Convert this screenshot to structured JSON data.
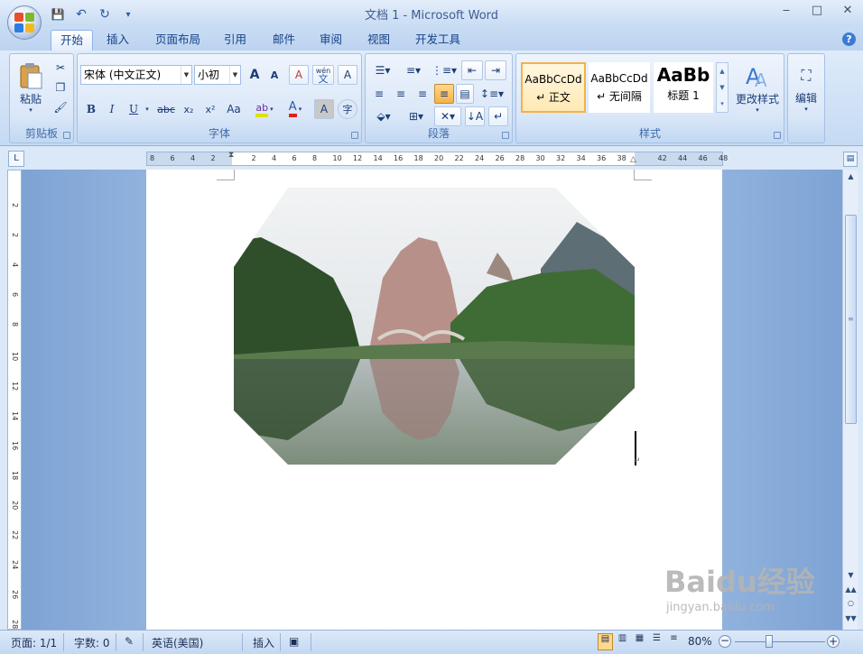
{
  "window": {
    "title": "文档 1 - Microsoft Word",
    "controls": {
      "minimize": "‒",
      "maximize": "□",
      "close": "✕"
    }
  },
  "quick_access": {
    "save": "💾",
    "undo": "↶",
    "redo": "↻",
    "customize": "▾"
  },
  "tabs": [
    {
      "label": "开始",
      "active": true
    },
    {
      "label": "插入"
    },
    {
      "label": "页面布局"
    },
    {
      "label": "引用"
    },
    {
      "label": "邮件"
    },
    {
      "label": "审阅"
    },
    {
      "label": "视图"
    },
    {
      "label": "开发工具"
    }
  ],
  "help": "?",
  "ribbon": {
    "clipboard": {
      "label": "剪贴板",
      "paste": "粘贴"
    },
    "font": {
      "label": "字体",
      "font_name": "宋体 (中文正文)",
      "font_size": "小初",
      "bold": "B",
      "italic": "I",
      "underline": "U",
      "strike": "abc",
      "subscript": "x₂",
      "superscript": "x²",
      "change_case": "Aa",
      "grow": "A",
      "shrink": "A",
      "clear": "A",
      "phonetic": "wén",
      "phonetic_char": "文",
      "border_char": "A",
      "char_shade": "A",
      "enclose": "字"
    },
    "paragraph": {
      "label": "段落"
    },
    "styles": {
      "label": "样式",
      "items": [
        {
          "preview": "AaBbCcDd",
          "name": "↵ 正文"
        },
        {
          "preview": "AaBbCcDd",
          "name": "↵ 无间隔"
        },
        {
          "preview": "AaBb",
          "name": "标题 1"
        }
      ],
      "change_styles": "更改样式"
    },
    "editing": {
      "label": "编辑"
    }
  },
  "ruler": {
    "h_ticks": [
      "8",
      "6",
      "4",
      "2",
      "",
      "2",
      "4",
      "6",
      "8",
      "10",
      "12",
      "14",
      "16",
      "18",
      "20",
      "22",
      "24",
      "26",
      "28",
      "30",
      "32",
      "34",
      "36",
      "38",
      "",
      "42",
      "44",
      "46",
      "48"
    ],
    "v_ticks": [
      "2",
      "2",
      "4",
      "6",
      "8",
      "10",
      "12",
      "14",
      "16",
      "18",
      "20",
      "22",
      "24",
      "26",
      "28"
    ]
  },
  "statusbar": {
    "page": "页面: 1/1",
    "words": "字数: 0",
    "language": "英语(美国)",
    "mode": "插入",
    "zoom": "80%"
  },
  "watermark": {
    "brand": "Baidu经验",
    "url": "jingyan.baidu.com"
  }
}
